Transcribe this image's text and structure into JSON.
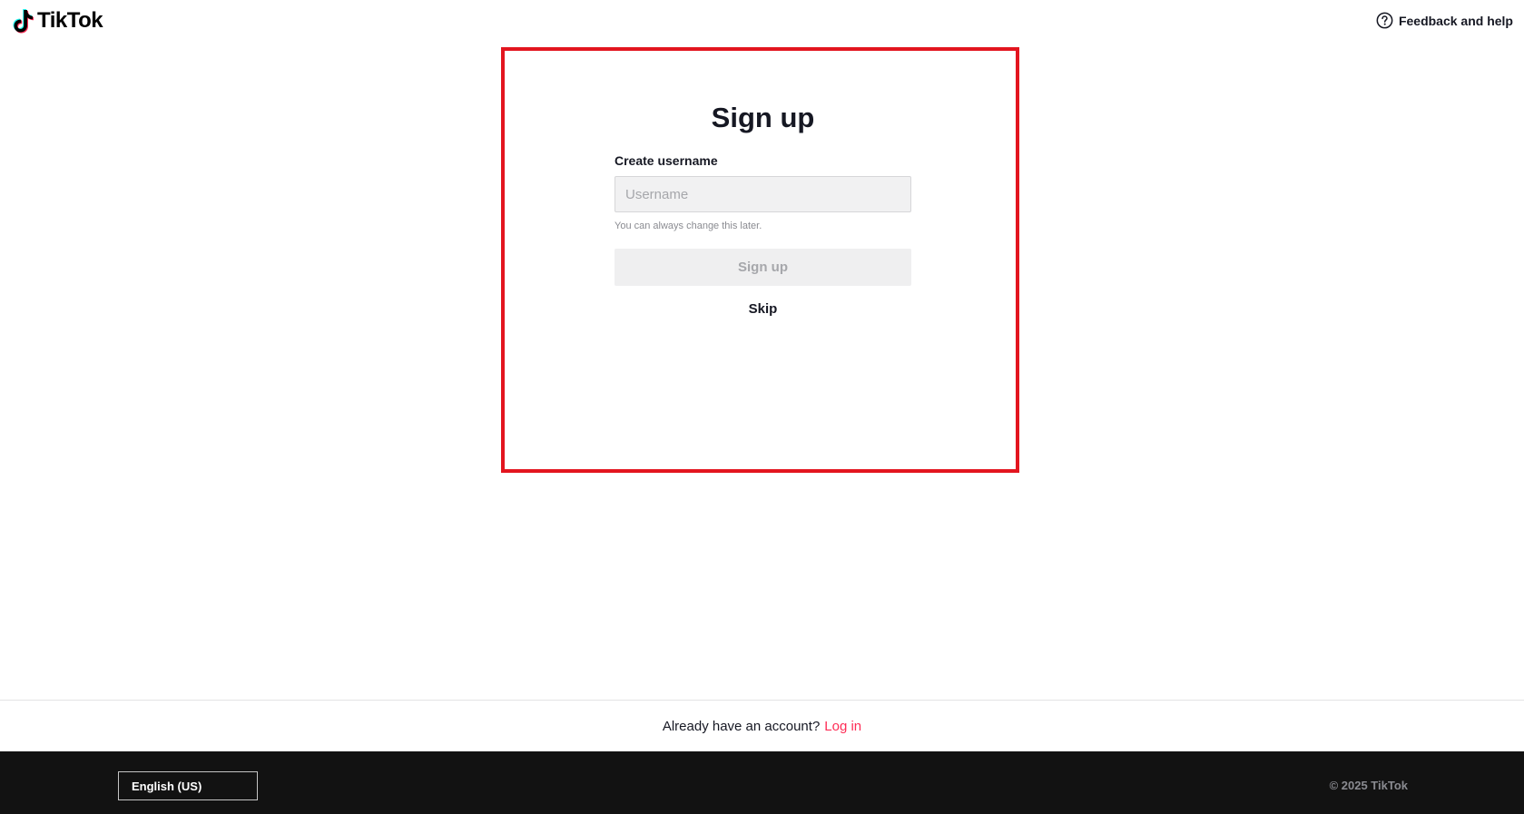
{
  "header": {
    "brand": "TikTok",
    "logo_icon": "tiktok-note-icon",
    "help_label": "Feedback and help",
    "help_icon": "question-circle-icon"
  },
  "form": {
    "title": "Sign up",
    "username_label": "Create username",
    "username_placeholder": "Username",
    "username_value": "",
    "hint": "You can always change this later.",
    "signup_button": "Sign up",
    "signup_button_state": "disabled",
    "skip_label": "Skip"
  },
  "login_bar": {
    "prompt": "Already have an account?",
    "link": "Log in"
  },
  "footer": {
    "language": "English (US)",
    "copyright": "© 2025 TikTok"
  },
  "colors": {
    "accent": "#fe2c55",
    "highlight_border": "#e3151f",
    "footer_bg": "#121212",
    "text_primary": "#161823"
  }
}
